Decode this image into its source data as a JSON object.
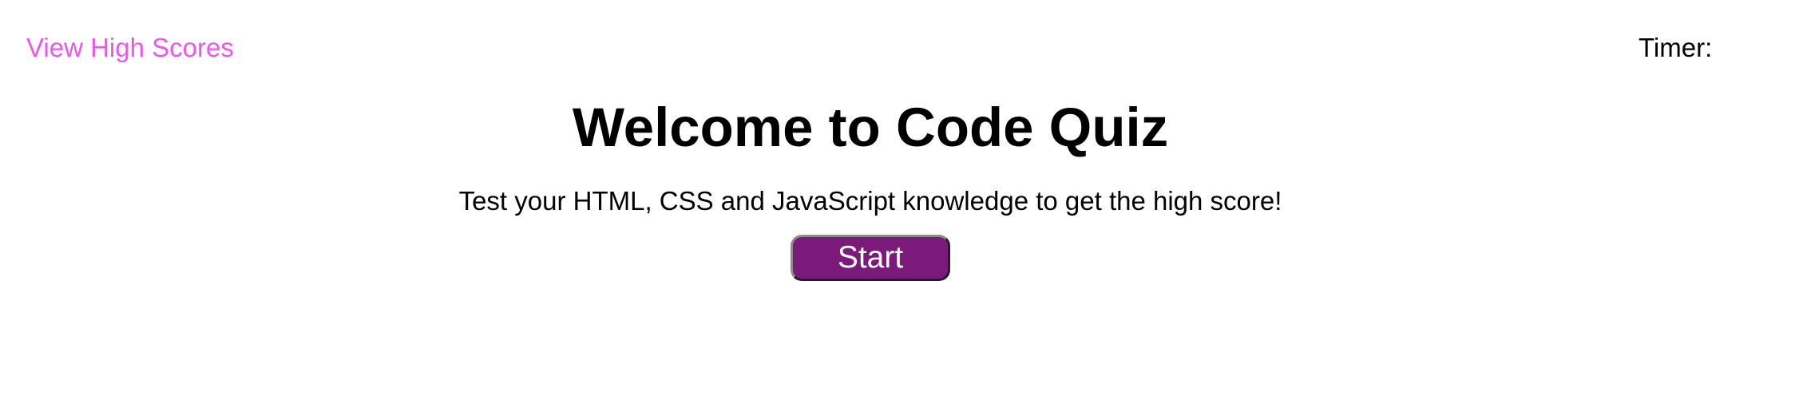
{
  "header": {
    "high_scores_label": "View High Scores",
    "timer_label": "Timer:",
    "timer_value": ""
  },
  "main": {
    "title": "Welcome to Code Quiz",
    "subtitle": "Test your HTML, CSS and JavaScript knowledge to get the high score!",
    "start_label": "Start"
  },
  "colors": {
    "link": "#ee55ee",
    "button_background": "#7b1a7b",
    "button_text": "#ffffff",
    "text": "#000000",
    "background": "#ffffff"
  }
}
